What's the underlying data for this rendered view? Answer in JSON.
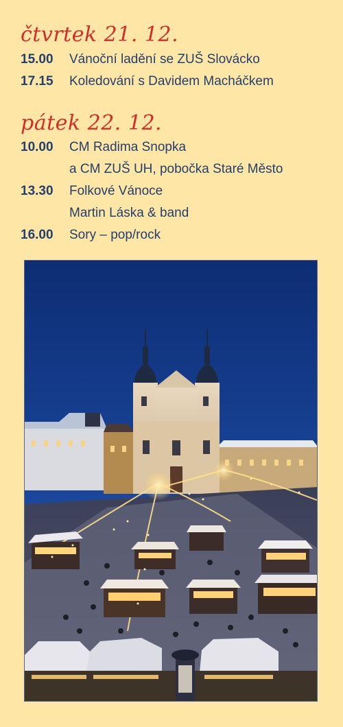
{
  "days": [
    {
      "title": "čtvrtek 21. 12.",
      "events": [
        {
          "time": "15.00",
          "lines": [
            "Vánoční ladění se ZUŠ Slovácko"
          ]
        },
        {
          "time": "17.15",
          "lines": [
            "Koledování s Davidem Macháčkem"
          ]
        }
      ]
    },
    {
      "title": "pátek 22. 12.",
      "events": [
        {
          "time": "10.00",
          "lines": [
            "CM Radima Snopka",
            "a CM ZUŠ UH, pobočka Staré Město"
          ]
        },
        {
          "time": "13.30",
          "lines": [
            "Folkové Vánoce",
            "Martin Láska & band"
          ]
        },
        {
          "time": "16.00",
          "lines": [
            "Sory – pop/rock"
          ]
        }
      ]
    }
  ],
  "colors": {
    "background": "#fde6a6",
    "day_title": "#d32d27",
    "text": "#243f6c"
  }
}
